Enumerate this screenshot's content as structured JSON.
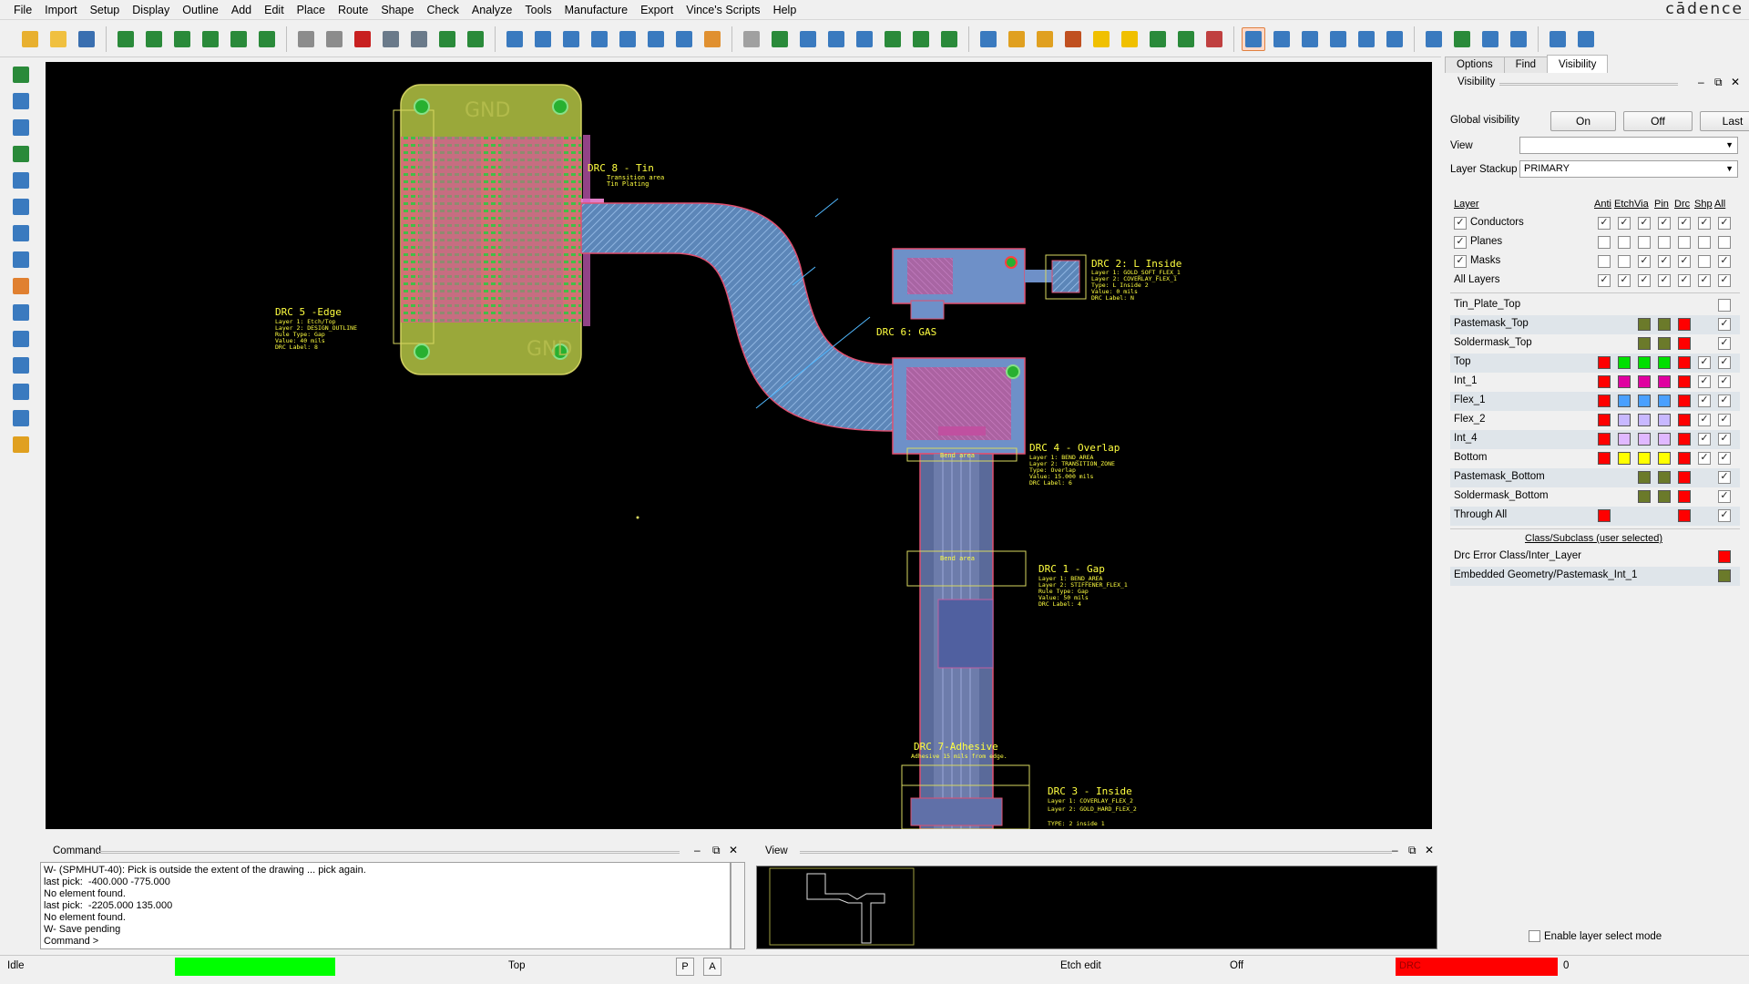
{
  "menu": [
    "File",
    "Import",
    "Setup",
    "Display",
    "Outline",
    "Add",
    "Edit",
    "Place",
    "Route",
    "Shape",
    "Check",
    "Analyze",
    "Tools",
    "Manufacture",
    "Export",
    "Vince's Scripts",
    "Help"
  ],
  "brand": "cādence",
  "toolbar_colors": [
    "#e8b030",
    "#f0c040",
    "#3a6fb0",
    "#2a8a3a",
    "#2a8a3a",
    "#2a8a3a",
    "#2a8a3a",
    "#2a8a3a",
    "#2a8a3a",
    "#8c8c8c",
    "#8c8c8c",
    "#c82020",
    "#6a7a8a",
    "#6a7a8a",
    "#2a8a3a",
    "#2a8a3a",
    "#3a7abf",
    "#3a7abf",
    "#3a7abf",
    "#3a7abf",
    "#3a7abf",
    "#3a7abf",
    "#3a7abf",
    "#e09030",
    "#a0a0a0",
    "#2a8a3a",
    "#3a7abf",
    "#3a7abf",
    "#3a7abf",
    "#2a8a3a",
    "#2a8a3a",
    "#2a8a3a",
    "#3a7abf",
    "#e0a020",
    "#e0a020",
    "#c05020",
    "#f0c000",
    "#f0c000",
    "#2a8a3a",
    "#2a8a3a",
    "#c04040",
    "#3a7abf",
    "#3a7abf",
    "#3a7abf",
    "#3a7abf",
    "#3a7abf",
    "#3a7abf",
    "#3a7abf",
    "#2a8a3a",
    "#3a7abf",
    "#3a7abf",
    "#3a7abf",
    "#3a7abf"
  ],
  "left_tool_colors": [
    "#2a8a3a",
    "#3a7abf",
    "#3a7abf",
    "#2a8a3a",
    "#3a7abf",
    "#3a7abf",
    "#3a7abf",
    "#3a7abf",
    "#e08030",
    "#3a7abf",
    "#3a7abf",
    "#3a7abf",
    "#3a7abf",
    "#3a7abf",
    "#e0a020"
  ],
  "board": {
    "labels": {
      "gnd_top": "GND",
      "gnd_bottom": "GND",
      "drc8_title": "DRC 8 - Tin",
      "drc8_l1": "Transition area",
      "drc8_l2": "Tin Plating",
      "drc5_title": "DRC 5 -Edge",
      "drc5_l1": "Layer 1: Etch/Top",
      "drc5_l2": "Layer 2: DESIGN_OUTLINE",
      "drc5_l3": "Rule Type: Gap",
      "drc5_l4": "Value: 40 mils",
      "drc5_l5": "DRC Label: 8",
      "drc2_title": "DRC 2: L Inside",
      "drc2_l1": "Layer 1: GOLD_SOFT_FLEX_1",
      "drc2_l2": "Layer 2: COVERLAY_FLEX_1",
      "drc2_l3": "Type: L Inside 2",
      "drc2_l4": "Value: 0 mils",
      "drc2_l5": "DRC Label: N",
      "drc6_title": "DRC 6: GAS",
      "drc4_title": "DRC 4 - Overlap",
      "drc4_l1": "Layer 1: BEND_AREA",
      "drc4_l2": "Layer 2: TRANSITION_ZONE",
      "drc4_l3": "Type: Overlap",
      "drc4_l4": "Value: 15.000 mils",
      "drc4_l5": "DRC Label: 6",
      "bend1": "Bend area",
      "bend2": "Bend area",
      "drc1_title": "DRC 1 - Gap",
      "drc1_l1": "Layer 1: BEND_AREA",
      "drc1_l2": "Layer 2: STIFFENER_FLEX_1",
      "drc1_l3": "Rule Type: Gap",
      "drc1_l4": "Value: 50 mils",
      "drc1_l5": "DRC Label: 4",
      "drc7_title": "DRC 7-Adhesive",
      "drc7_l1": "Adhesive 15 mils from edge.",
      "drc3_title": "DRC 3 - Inside",
      "drc3_l1": "Layer 1: COVERLAY_FLEX_2",
      "drc3_l2": "Layer 2: GOLD_HARD_FLEX_2",
      "drc3_l3": "TYPE: 2 inside 1"
    }
  },
  "panel": {
    "tabs": [
      "Options",
      "Find",
      "Visibility"
    ],
    "visibility_title": "Visibility",
    "global_visibility_label": "Global visibility",
    "btn_on": "On",
    "btn_off": "Off",
    "btn_last": "Last",
    "view_label": "View",
    "view_value": "",
    "stackup_label": "Layer Stackup",
    "stackup_value": "PRIMARY",
    "col_layer": "Layer",
    "columns": [
      "Anti",
      "Etch",
      "Via",
      "Pin",
      "Drc",
      "Shp",
      "All"
    ],
    "class_subclass": "Class/Subclass (user selected)",
    "enable_layer_select": "Enable layer select mode"
  },
  "groups": [
    {
      "name": "Conductors",
      "checked": true,
      "cells": [
        "c",
        "c",
        "c",
        "c",
        "c",
        "c",
        "c"
      ]
    },
    {
      "name": "Planes",
      "checked": true,
      "cells": [
        "u",
        "u",
        "u",
        "u",
        "u",
        "u",
        "u"
      ]
    },
    {
      "name": "Masks",
      "checked": true,
      "cells": [
        "u",
        "u",
        "c",
        "c",
        "c",
        "u",
        "c"
      ]
    },
    {
      "name": "All Layers",
      "checked": null,
      "cells": [
        "c",
        "c",
        "c",
        "c",
        "c",
        "c",
        "c"
      ]
    }
  ],
  "layers": [
    {
      "name": "Tin_Plate_Top",
      "shade": false,
      "cells": [
        "",
        "",
        "",
        "",
        "",
        "",
        "u"
      ]
    },
    {
      "name": "Pastemask_Top",
      "shade": true,
      "cells": [
        "",
        "",
        "#6b7a2a",
        "#6b7a2a",
        "#ff0000",
        "",
        "c"
      ]
    },
    {
      "name": "Soldermask_Top",
      "shade": false,
      "cells": [
        "",
        "",
        "#6b7a2a",
        "#6b7a2a",
        "#ff0000",
        "",
        "c"
      ]
    },
    {
      "name": "Top",
      "shade": true,
      "cells": [
        "#ff0000",
        "#00e000",
        "#00e000",
        "#00e000",
        "#ff0000",
        "c",
        "c"
      ]
    },
    {
      "name": "Int_1",
      "shade": false,
      "cells": [
        "#ff0000",
        "#e000a0",
        "#e000a0",
        "#e000a0",
        "#ff0000",
        "c",
        "c"
      ]
    },
    {
      "name": "Flex_1",
      "shade": true,
      "cells": [
        "#ff0000",
        "#4aa0ff",
        "#4aa0ff",
        "#4aa0ff",
        "#ff0000",
        "c",
        "c"
      ]
    },
    {
      "name": "Flex_2",
      "shade": false,
      "cells": [
        "#ff0000",
        "#c8b8ff",
        "#c8b8ff",
        "#c8b8ff",
        "#ff0000",
        "c",
        "c"
      ]
    },
    {
      "name": "Int_4",
      "shade": true,
      "cells": [
        "#ff0000",
        "#e0b8ff",
        "#e0b8ff",
        "#e0b8ff",
        "#ff0000",
        "c",
        "c"
      ]
    },
    {
      "name": "Bottom",
      "shade": false,
      "cells": [
        "#ff0000",
        "#ffff00",
        "#ffff00",
        "#ffff00",
        "#ff0000",
        "c",
        "c"
      ]
    },
    {
      "name": "Pastemask_Bottom",
      "shade": true,
      "cells": [
        "",
        "",
        "#6b7a2a",
        "#6b7a2a",
        "#ff0000",
        "",
        "c"
      ]
    },
    {
      "name": "Soldermask_Bottom",
      "shade": false,
      "cells": [
        "",
        "",
        "#6b7a2a",
        "#6b7a2a",
        "#ff0000",
        "",
        "c"
      ]
    },
    {
      "name": "Through All",
      "shade": true,
      "cells": [
        "#ff0000",
        "",
        "",
        "",
        "#ff0000",
        "",
        "c"
      ]
    }
  ],
  "user_classes": [
    {
      "name": "Drc Error Class/Inter_Layer",
      "color": "#ff0000"
    },
    {
      "name": "Embedded Geometry/Pastemask_Int_1",
      "color": "#6b7a2a"
    }
  ],
  "command": {
    "title": "Command",
    "lines": [
      "W- (SPMHUT-40): Pick is outside the extent of the drawing ... pick again.",
      "last pick:  -400.000 -775.000",
      "No element found.",
      "last pick:  -2205.000 135.000",
      "No element found.",
      "W- Save pending",
      "Command >"
    ]
  },
  "view_title": "View",
  "status": {
    "state": "Idle",
    "layer": "Top",
    "p": "P",
    "a": "A",
    "mode": "Etch edit",
    "off": "Off",
    "drc": "DRC",
    "drc_count": "0",
    "idle_color": "#00ff00",
    "drc_color": "#ff0000"
  }
}
